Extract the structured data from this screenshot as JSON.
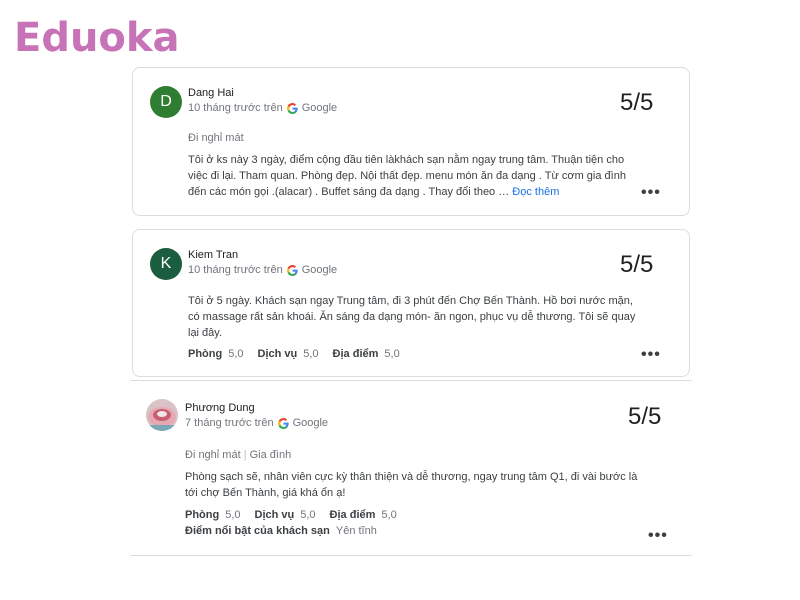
{
  "brand": {
    "logo_text": "Eduoka",
    "logo_color": "#c873b8"
  },
  "reviews": [
    {
      "avatar_letter": "D",
      "avatar_color": "#2e7d32",
      "name": "Dang Hai",
      "time": "10 tháng trước trên",
      "source": "Google",
      "score": "5/5",
      "trip_type": "Đi nghỉ mát",
      "text": "Tôi ở ks này 3 ngày, điểm cộng đầu tiên làkhách sạn nằm ngay trung tâm. Thuận tiện cho việc đi lại. Tham quan. Phòng đẹp. Nội thất đẹp. menu món ăn đa dạng . Từ cơm gia đình đến các món gọi .(alacar) . Buffet sáng đa dạng . Thay đổi theo …",
      "read_more": "Đọc thêm",
      "menu_icon": "more-dots-icon"
    },
    {
      "avatar_letter": "K",
      "avatar_color": "#1b5e3f",
      "name": "Kiem Tran",
      "time": "10 tháng trước trên",
      "source": "Google",
      "score": "5/5",
      "text": "Tôi ở 5 ngày. Khách sạn ngay Trung tâm, đi 3 phút đến Chợ Bến Thành. Hồ bơi nước mặn, có massage rất sản khoái. Ăn sáng đa dạng món- ăn ngon, phục vụ dễ thương. Tôi sẽ quay lại đây.",
      "ratings": [
        {
          "label": "Phòng",
          "value": "5,0"
        },
        {
          "label": "Dịch vụ",
          "value": "5,0"
        },
        {
          "label": "Địa điểm",
          "value": "5,0"
        }
      ],
      "menu_icon": "more-dots-icon"
    },
    {
      "avatar_icon": "profile-photo",
      "name": "Phương Dung",
      "time": "7 tháng trước trên",
      "source": "Google",
      "score": "5/5",
      "trip_type": "Đi nghỉ mát",
      "trip_sep": "|",
      "trip_type2": "Gia đình",
      "text": "Phòng sạch sẽ, nhân viên cực kỳ thân thiện và dễ thương, ngay trung tâm Q1, đi vài bước là tới chợ Bến Thành, giá khá ổn ạ!",
      "ratings": [
        {
          "label": "Phòng",
          "value": "5,0"
        },
        {
          "label": "Dịch vụ",
          "value": "5,0"
        },
        {
          "label": "Địa điểm",
          "value": "5,0"
        }
      ],
      "highlight_label": "Điểm nổi bật của khách sạn",
      "highlight_value": "Yên tĩnh",
      "menu_icon": "more-dots-icon"
    }
  ]
}
